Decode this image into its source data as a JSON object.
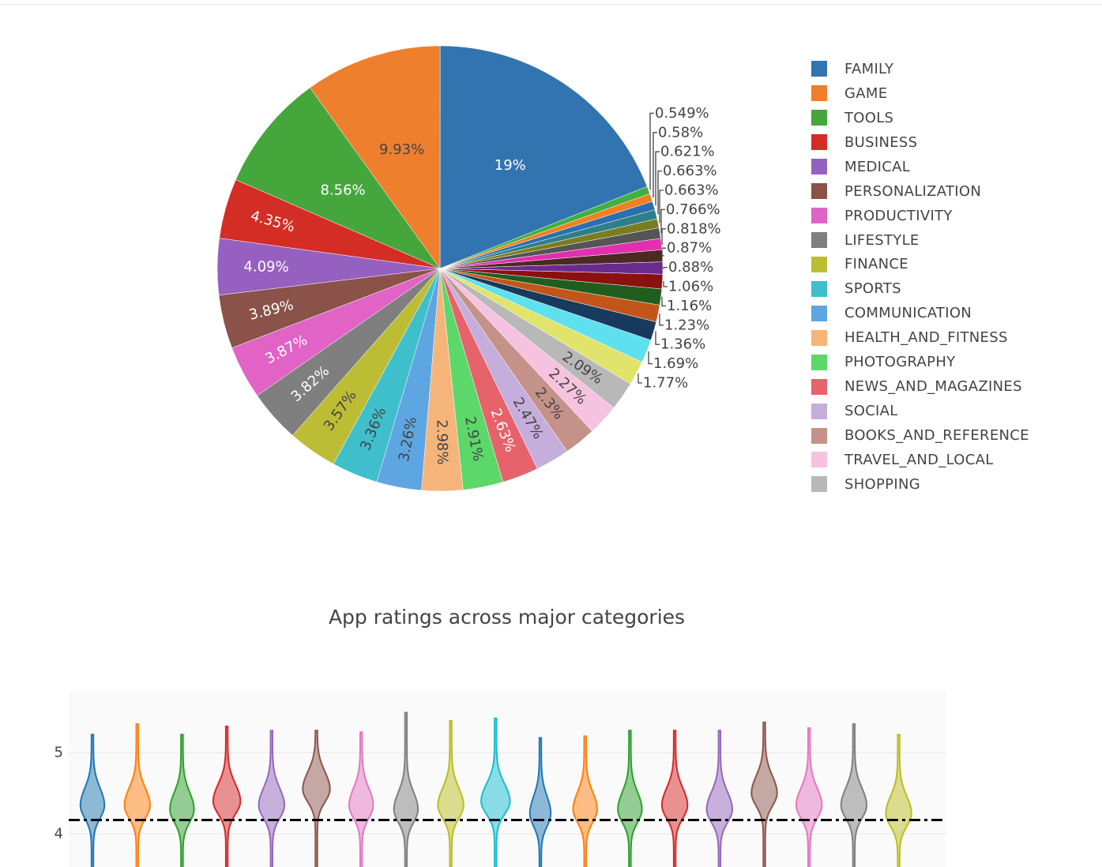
{
  "chart_data": [
    {
      "type": "pie",
      "direction": "counterclockwise",
      "slices": [
        {
          "label": "FAMILY",
          "value": 19,
          "text": "19%",
          "color": "#3274b0"
        },
        {
          "label": "GAME",
          "value": 9.93,
          "text": "9.93%",
          "color": "#ee7f2d"
        },
        {
          "label": "TOOLS",
          "value": 8.56,
          "text": "8.56%",
          "color": "#45a63c"
        },
        {
          "label": "BUSINESS",
          "value": 4.35,
          "text": "4.35%",
          "color": "#d42d25"
        },
        {
          "label": "MEDICAL",
          "value": 4.09,
          "text": "4.09%",
          "color": "#9660c0"
        },
        {
          "label": "PERSONALIZATION",
          "value": 3.89,
          "text": "3.89%",
          "color": "#8a5248"
        },
        {
          "label": "PRODUCTIVITY",
          "value": 3.87,
          "text": "3.87%",
          "color": "#e163c5"
        },
        {
          "label": "LIFESTYLE",
          "value": 3.82,
          "text": "3.82%",
          "color": "#7f7f7f"
        },
        {
          "label": "FINANCE",
          "value": 3.57,
          "text": "3.57%",
          "color": "#bcbd35"
        },
        {
          "label": "SPORTS",
          "value": 3.36,
          "text": "3.36%",
          "color": "#3fbfcc"
        },
        {
          "label": "COMMUNICATION",
          "value": 3.26,
          "text": "3.26%",
          "color": "#5ea6e2"
        },
        {
          "label": "HEALTH_AND_FITNESS",
          "value": 2.98,
          "text": "2.98%",
          "color": "#f5b57a"
        },
        {
          "label": "PHOTOGRAPHY",
          "value": 2.91,
          "text": "2.91%",
          "color": "#5cd86a"
        },
        {
          "label": "NEWS_AND_MAGAZINES",
          "value": 2.63,
          "text": "2.63%",
          "color": "#e6636b"
        },
        {
          "label": "SOCIAL",
          "value": 2.47,
          "text": "2.47%",
          "color": "#c6aedc"
        },
        {
          "label": "BOOKS_AND_REFERENCE",
          "value": 2.3,
          "text": "2.3%",
          "color": "#c49288"
        },
        {
          "label": "TRAVEL_AND_LOCAL",
          "value": 2.27,
          "text": "2.27%",
          "color": "#f5c2df"
        },
        {
          "label": "SHOPPING",
          "value": 2.09,
          "text": "2.09%",
          "color": "#b8b8b8"
        },
        {
          "value": 1.77,
          "text": "1.77%",
          "color": "#e0e46a"
        },
        {
          "value": 1.69,
          "text": "1.69%",
          "color": "#5ee0ee"
        },
        {
          "value": 1.36,
          "text": "1.36%",
          "color": "#183a5c"
        },
        {
          "value": 1.23,
          "text": "1.23%",
          "color": "#c2561a"
        },
        {
          "value": 1.16,
          "text": "1.16%",
          "color": "#1f5e1f"
        },
        {
          "value": 1.06,
          "text": "1.06%",
          "color": "#8b1010"
        },
        {
          "value": 0.88,
          "text": "0.88%",
          "color": "#6a2b8f"
        },
        {
          "value": 0.87,
          "text": "0.87%",
          "color": "#4a2a22"
        },
        {
          "value": 0.818,
          "text": "0.818%",
          "color": "#e030b0"
        },
        {
          "value": 0.766,
          "text": "0.766%",
          "color": "#555555"
        },
        {
          "value": 0.663,
          "text": "0.663%",
          "color": "#7a7d1f"
        },
        {
          "value": 0.663,
          "text": "0.663%",
          "color": "#2f7f8a"
        },
        {
          "value": 0.621,
          "text": "0.621%",
          "color": "#2c6fb0"
        },
        {
          "value": 0.58,
          "text": "0.58%",
          "color": "#f08020"
        },
        {
          "value": 0.549,
          "text": "0.549%",
          "color": "#40b040"
        }
      ],
      "legend_placement": "right"
    },
    {
      "type": "violin",
      "title": "App ratings across major categories",
      "ylim": [
        3.6,
        5.75
      ],
      "yticks": [
        4,
        5
      ],
      "grid": true,
      "reference_line": {
        "y": 4.17,
        "style": "dashdot",
        "color": "#000000"
      },
      "violin_count": 19,
      "colors": [
        "#1f77b4",
        "#ff7f0e",
        "#2ca02c",
        "#d62728",
        "#9467bd",
        "#8c564b",
        "#e377c2",
        "#7f7f7f",
        "#bcbd22",
        "#17becf"
      ]
    }
  ]
}
